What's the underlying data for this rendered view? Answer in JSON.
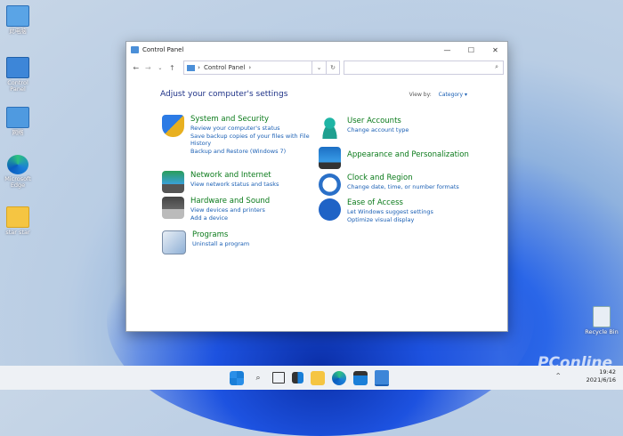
{
  "desktop": {
    "icons": [
      {
        "label": "此电脑",
        "icon": "computer-icon"
      },
      {
        "label": "Control Panel",
        "icon": "control-panel-icon"
      },
      {
        "label": "网络",
        "icon": "network-icon"
      },
      {
        "label": "Microsoft Edge",
        "icon": "edge-icon"
      },
      {
        "label": "star star",
        "icon": "folder-icon"
      }
    ],
    "recycle_bin": "Recycle Bin"
  },
  "window": {
    "title": "Control Panel",
    "minimize": "—",
    "maximize": "☐",
    "close": "✕",
    "address": {
      "back": "←",
      "forward": "→",
      "recent": "⌄",
      "up": "↑",
      "separator": "›",
      "location": "Control Panel",
      "dropdown": "⌄",
      "refresh": "↻",
      "search_icon": "⌕"
    },
    "heading": "Adjust your computer's settings",
    "view_by_label": "View by:",
    "view_by_value": "Category ▾",
    "categories_left": [
      {
        "title": "System and Security",
        "icon": "shield-icon",
        "links": [
          "Review your computer's status",
          "Save backup copies of your files with File",
          "History",
          "Backup and Restore (Windows 7)"
        ]
      },
      {
        "title": "Network and Internet",
        "icon": "network-globe-icon",
        "links": [
          "View network status and tasks"
        ]
      },
      {
        "title": "Hardware and Sound",
        "icon": "printer-icon",
        "links": [
          "View devices and printers",
          "Add a device"
        ]
      },
      {
        "title": "Programs",
        "icon": "programs-icon",
        "links": [
          "Uninstall a program"
        ]
      }
    ],
    "categories_right": [
      {
        "title": "User Accounts",
        "icon": "user-icon",
        "links": [
          "Change account type"
        ]
      },
      {
        "title": "Appearance and Personalization",
        "icon": "monitor-icon",
        "links": []
      },
      {
        "title": "Clock and Region",
        "icon": "clock-icon",
        "links": [
          "Change date, time, or number formats"
        ]
      },
      {
        "title": "Ease of Access",
        "icon": "accessibility-icon",
        "links": [
          "Let Windows suggest settings",
          "Optimize visual display"
        ]
      }
    ]
  },
  "taskbar": {
    "items": [
      "start-icon",
      "search-icon",
      "task-view-icon",
      "widgets-icon",
      "file-explorer-icon",
      "edge-icon",
      "store-icon",
      "control-panel-icon"
    ],
    "time": "19:42",
    "date": "2021/6/16",
    "tray_chevron": "^"
  },
  "watermark": "PConline"
}
